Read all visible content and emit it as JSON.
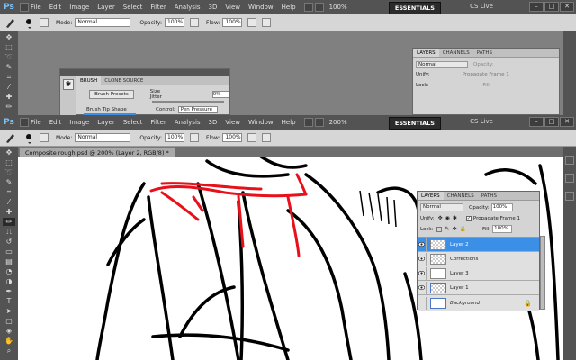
{
  "app": {
    "logo": "Ps",
    "menu_items": [
      "File",
      "Edit",
      "Image",
      "Layer",
      "Select",
      "Filter",
      "Analysis",
      "3D",
      "View",
      "Window",
      "Help"
    ],
    "zoom_top": "100%",
    "zoom_bottom": "200%",
    "workspace": "ESSENTIALS",
    "cs_live": "CS Live",
    "accent_color": "#3c8fe7"
  },
  "options": {
    "mode_label": "Mode:",
    "mode_value": "Normal",
    "opacity_label": "Opacity:",
    "opacity_value": "100%",
    "flow_label": "Flow:",
    "flow_value": "100%"
  },
  "brush_panel": {
    "tabs": [
      "BRUSH",
      "CLONE SOURCE"
    ],
    "brush_presets_button": "Brush Presets",
    "size_jitter_label": "Size Jitter",
    "size_jitter_value": "0%",
    "brush_tip_shape": "Brush Tip Shape",
    "control_label": "Control:",
    "control_value": "Pen Pressure"
  },
  "layers_panel_top": {
    "tabs": [
      "LAYERS",
      "CHANNELS",
      "PATHS"
    ],
    "blend_mode": "Normal",
    "opacity_label": "Opacity:",
    "unify_label": "Unify:",
    "propagate_label": "Propagate Frame 1",
    "lock_label": "Lock:",
    "fill_label": "Fill:"
  },
  "document": {
    "tab_title": "Composite rough.psd @ 200% (Layer 2, RGB/8) *"
  },
  "layers_panel": {
    "tabs": [
      "LAYERS",
      "CHANNELS",
      "PATHS"
    ],
    "blend_mode": "Normal",
    "opacity_label": "Opacity:",
    "opacity_value": "100%",
    "unify_label": "Unify:",
    "propagate_label": "Propagate Frame 1",
    "lock_label": "Lock:",
    "fill_label": "Fill:",
    "fill_value": "100%",
    "layers": [
      {
        "name": "Layer 2",
        "visible": true,
        "selected": true
      },
      {
        "name": "Corrections",
        "visible": true,
        "selected": false
      },
      {
        "name": "Layer 3",
        "visible": true,
        "selected": false
      },
      {
        "name": "Layer 1",
        "visible": true,
        "selected": false
      },
      {
        "name": "Background",
        "visible": false,
        "selected": false
      }
    ]
  }
}
